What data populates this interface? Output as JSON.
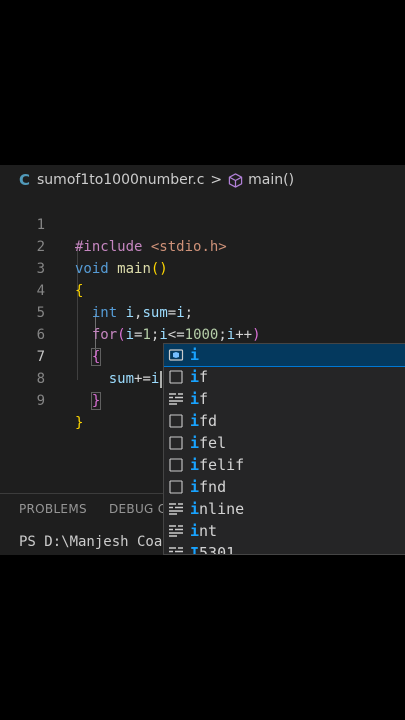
{
  "breadcrumb": {
    "lang_icon": "C",
    "file": "sumof1to1000number.c",
    "separator": ">",
    "symbol_icon": "cube-icon",
    "symbol": "main()"
  },
  "code_lines": [
    {
      "n": "1"
    },
    {
      "n": "2"
    },
    {
      "n": "3"
    },
    {
      "n": "4"
    },
    {
      "n": "5"
    },
    {
      "n": "6"
    },
    {
      "n": "7"
    },
    {
      "n": "8"
    },
    {
      "n": "9"
    }
  ],
  "code": {
    "l1_include": "#include",
    "l1_header": "<stdio.h>",
    "l2_type": "void",
    "l2_fn": "main",
    "l2_parens": "()",
    "l3_brace": "{",
    "l4_type": "int",
    "l4_rest_i": "i",
    "l4_comma": ",",
    "l4_sum": "sum",
    "l4_eq": "=",
    "l4_i2": "i",
    "l4_semi": ";",
    "l5_for": "for",
    "l5_open": "(",
    "l5_i1": "i",
    "l5_eq": "=",
    "l5_one": "1",
    "l5_semi1": ";",
    "l5_i2": "i",
    "l5_le": "<=",
    "l5_thousand": "1000",
    "l5_semi2": ";",
    "l5_i3": "i",
    "l5_inc": "++",
    "l5_close": ")",
    "l6_brace": "{",
    "l7_sum": "sum",
    "l7_op": "+=",
    "l7_i": "i",
    "l8_brace": "}",
    "l9_brace": "}"
  },
  "suggestions": [
    {
      "label": "i",
      "match": "i",
      "rest": "",
      "icon": "variable-icon",
      "selected": true
    },
    {
      "label": "if",
      "match": "i",
      "rest": "f",
      "icon": "snippet-icon",
      "selected": false
    },
    {
      "label": "if",
      "match": "i",
      "rest": "f",
      "icon": "keyword-icon",
      "selected": false
    },
    {
      "label": "ifd",
      "match": "i",
      "rest": "fd",
      "icon": "snippet-icon",
      "selected": false
    },
    {
      "label": "ifel",
      "match": "i",
      "rest": "fel",
      "icon": "snippet-icon",
      "selected": false
    },
    {
      "label": "ifelif",
      "match": "i",
      "rest": "felif",
      "icon": "snippet-icon",
      "selected": false
    },
    {
      "label": "ifnd",
      "match": "i",
      "rest": "fnd",
      "icon": "snippet-icon",
      "selected": false
    },
    {
      "label": "inline",
      "match": "i",
      "rest": "nline",
      "icon": "keyword-icon",
      "selected": false
    },
    {
      "label": "int",
      "match": "i",
      "rest": "nt",
      "icon": "keyword-icon",
      "selected": false
    },
    {
      "label": "I5301",
      "match": "I",
      "rest": "5301",
      "icon": "keyword-icon",
      "selected": false
    }
  ],
  "panel": {
    "problems_tab": "PROBLEMS",
    "debug_tab": "DEBUG CO",
    "terminal_text": "PS D:\\Manjesh Coac"
  },
  "colors": {
    "editor_bg": "#1e1e1e",
    "selection_bg": "#04395e",
    "match_highlight": "#18a3ff"
  }
}
